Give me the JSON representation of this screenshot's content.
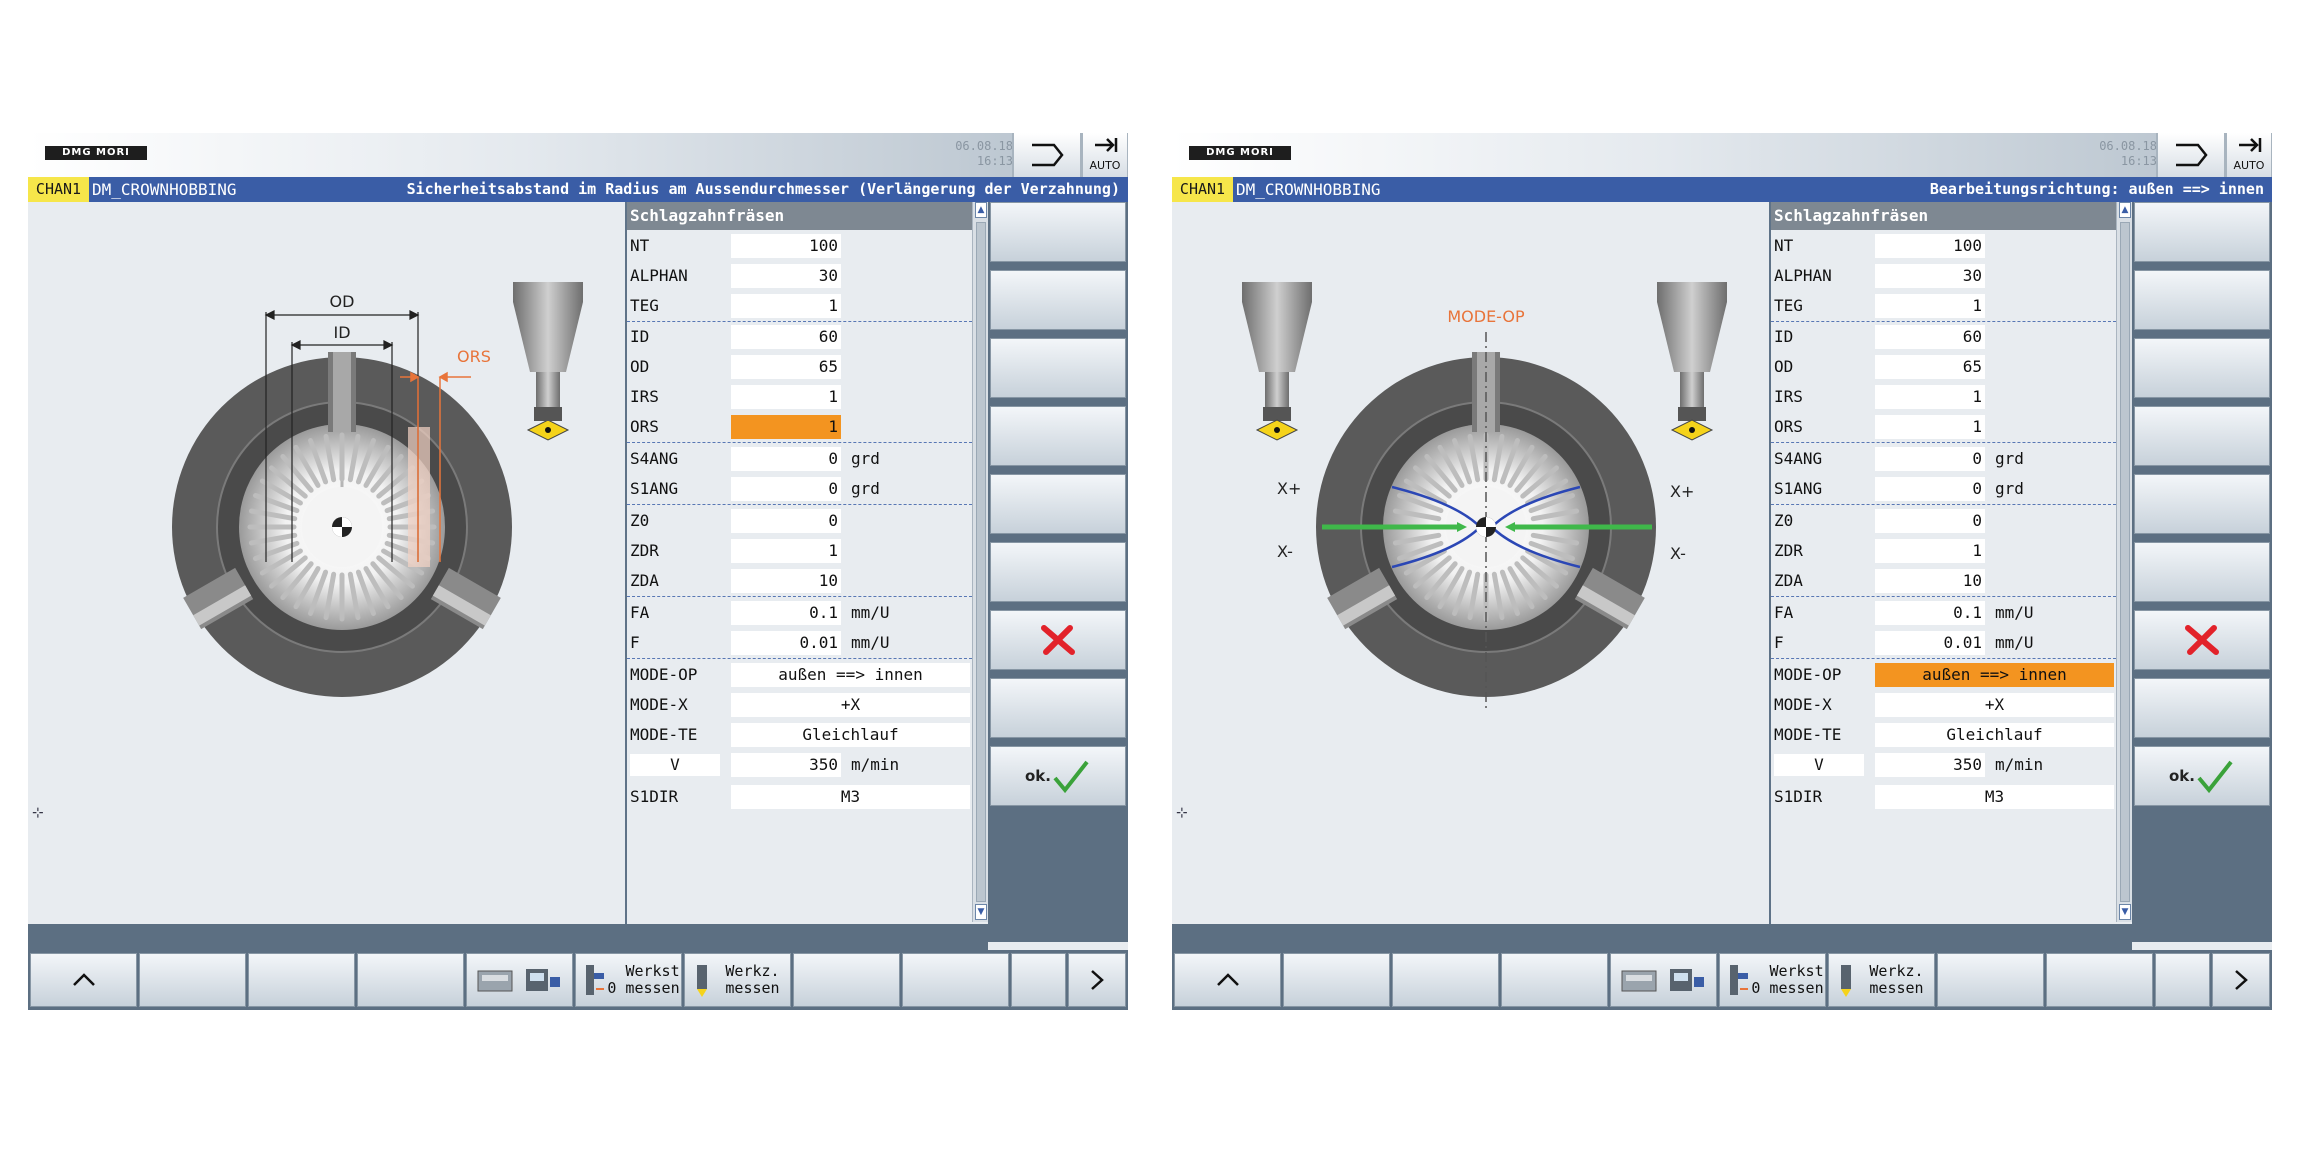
{
  "colors": {
    "title_bar": "#3a5da6",
    "channel_badge": "#f6e64a",
    "highlight": "#f39420",
    "softkey_bg": "#5c6f82",
    "cancel_x": "#e2222a",
    "ok_check": "#3aa23a",
    "dim_orange": "#e8743a",
    "path_blue": "#2b47b5",
    "path_green": "#3fb84a"
  },
  "panels": [
    {
      "brand": "DMG MORI",
      "date": "06.08.18",
      "time": "16:13",
      "header_auto": "AUTO",
      "channel": "CHAN1",
      "program": "DM_CROWNHOBBING",
      "hint": "Sicherheitsabstand im Radius am Aussendurchmesser (Verlängerung der Verzahnung)",
      "form_title": "Schlagzahnfräsen",
      "fields": [
        {
          "label": "NT",
          "value": "100",
          "unit": ""
        },
        {
          "label": "ALPHAN",
          "value": "30",
          "unit": ""
        },
        {
          "label": "TEG",
          "value": "1",
          "unit": ""
        },
        {
          "label": "ID",
          "value": "60",
          "unit": ""
        },
        {
          "label": "OD",
          "value": "65",
          "unit": ""
        },
        {
          "label": "IRS",
          "value": "1",
          "unit": ""
        },
        {
          "label": "ORS",
          "value": "1",
          "unit": ""
        },
        {
          "label": "S4ANG",
          "value": "0",
          "unit": "grd"
        },
        {
          "label": "S1ANG",
          "value": "0",
          "unit": "grd"
        },
        {
          "label": "Z0",
          "value": "0",
          "unit": ""
        },
        {
          "label": "ZDR",
          "value": "1",
          "unit": ""
        },
        {
          "label": "ZDA",
          "value": "10",
          "unit": ""
        },
        {
          "label": "FA",
          "value": "0.1",
          "unit": "mm/U"
        },
        {
          "label": "F",
          "value": "0.01",
          "unit": "mm/U"
        },
        {
          "label": "MODE-OP",
          "value": "außen ==> innen",
          "unit": ""
        },
        {
          "label": "MODE-X",
          "value": "+X",
          "unit": ""
        },
        {
          "label": "MODE-TE",
          "value": "Gleichlauf",
          "unit": ""
        },
        {
          "label": "V",
          "value": "350",
          "unit": "m/min"
        },
        {
          "label": "S1DIR",
          "value": "M3",
          "unit": ""
        }
      ],
      "highlighted_field": "ORS",
      "diagram_labels": {
        "od": "OD",
        "id": "ID",
        "ors": "ORS"
      },
      "ok_label": "ok.",
      "hsoft": {
        "up": "^",
        "werkst_1": "Werkst",
        "werkst_2": "0 messen",
        "werkz_1": "Werkz.",
        "werkz_2": "messen",
        "next": ">"
      }
    },
    {
      "brand": "DMG MORI",
      "date": "06.08.18",
      "time": "16:13",
      "header_auto": "AUTO",
      "channel": "CHAN1",
      "program": "DM_CROWNHOBBING",
      "hint": "Bearbeitungsrichtung: außen ==> innen",
      "form_title": "Schlagzahnfräsen",
      "fields": [
        {
          "label": "NT",
          "value": "100",
          "unit": ""
        },
        {
          "label": "ALPHAN",
          "value": "30",
          "unit": ""
        },
        {
          "label": "TEG",
          "value": "1",
          "unit": ""
        },
        {
          "label": "ID",
          "value": "60",
          "unit": ""
        },
        {
          "label": "OD",
          "value": "65",
          "unit": ""
        },
        {
          "label": "IRS",
          "value": "1",
          "unit": ""
        },
        {
          "label": "ORS",
          "value": "1",
          "unit": ""
        },
        {
          "label": "S4ANG",
          "value": "0",
          "unit": "grd"
        },
        {
          "label": "S1ANG",
          "value": "0",
          "unit": "grd"
        },
        {
          "label": "Z0",
          "value": "0",
          "unit": ""
        },
        {
          "label": "ZDR",
          "value": "1",
          "unit": ""
        },
        {
          "label": "ZDA",
          "value": "10",
          "unit": ""
        },
        {
          "label": "FA",
          "value": "0.1",
          "unit": "mm/U"
        },
        {
          "label": "F",
          "value": "0.01",
          "unit": "mm/U"
        },
        {
          "label": "MODE-OP",
          "value": "außen ==> innen",
          "unit": ""
        },
        {
          "label": "MODE-X",
          "value": "+X",
          "unit": ""
        },
        {
          "label": "MODE-TE",
          "value": "Gleichlauf",
          "unit": ""
        },
        {
          "label": "V",
          "value": "350",
          "unit": "m/min"
        },
        {
          "label": "S1DIR",
          "value": "M3",
          "unit": ""
        }
      ],
      "highlighted_field": "MODE-OP",
      "diagram_labels": {
        "mode_op": "MODE-OP",
        "xplus": "X+",
        "xminus": "X-"
      },
      "ok_label": "ok.",
      "hsoft": {
        "up": "^",
        "werkst_1": "Werkst",
        "werkst_2": "0 messen",
        "werkz_1": "Werkz.",
        "werkz_2": "messen",
        "next": ">"
      }
    }
  ]
}
